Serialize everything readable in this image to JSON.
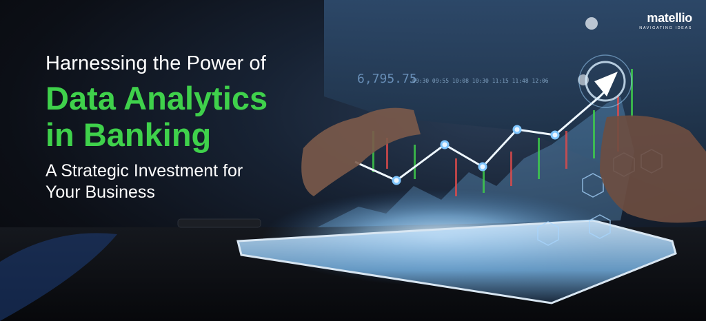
{
  "headline": {
    "line1": "Harnessing the Power of",
    "line2": "Data Analytics",
    "line3": "in Banking",
    "line4a": "A Strategic Investment for",
    "line4b": "Your Business"
  },
  "logo": {
    "name": "matellio",
    "tagline": "NAVIGATING IDEAS"
  },
  "ticker": {
    "price": "6,795.75",
    "times": [
      "09:30",
      "09:55",
      "10:08",
      "10:30",
      "11:15",
      "11:48",
      "12:06"
    ]
  },
  "colors": {
    "accent_green": "#3fd14b",
    "text_white": "#ffffff",
    "glow_blue": "#8fd0ff"
  },
  "icons": [
    "target-icon",
    "card-icon",
    "chart-icon",
    "globe-icon",
    "rocket-icon"
  ]
}
